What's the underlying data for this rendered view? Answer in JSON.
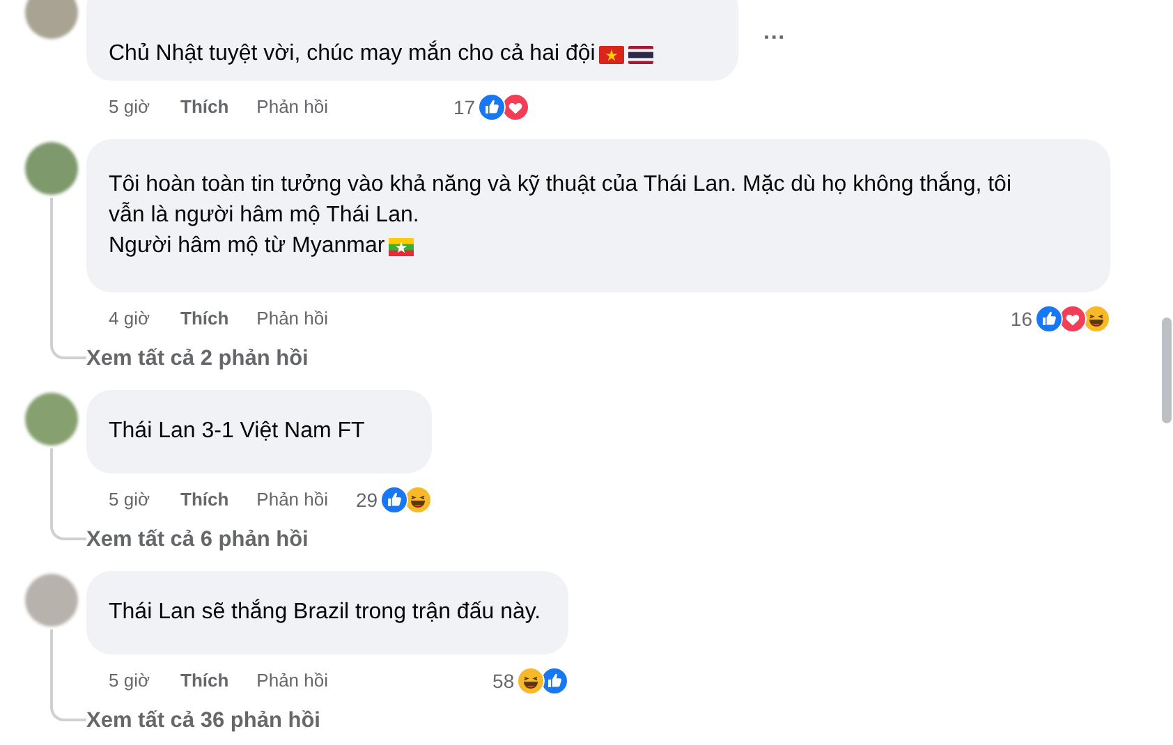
{
  "comments": [
    {
      "text": [
        "Chủ Nhật tuyệt vời, chúc may mắn cho cả hai đội"
      ],
      "flags": [
        {
          "kind": "vietnam"
        },
        {
          "kind": "thailand"
        }
      ],
      "time": "5 giờ",
      "like": "Thích",
      "reply": "Phản hồi",
      "reaction_count": "17",
      "reactions": [
        {
          "kind": "like"
        },
        {
          "kind": "love"
        }
      ],
      "more": "···"
    },
    {
      "text": [
        "Tôi hoàn toàn tin tưởng vào khả năng và kỹ thuật của Thái Lan. Mặc dù họ không thắng, tôi vẫn là người hâm mộ Thái Lan.",
        "Người hâm mộ từ Myanmar"
      ],
      "flags": [
        {
          "kind": "myanmar"
        }
      ],
      "time": "4 giờ",
      "like": "Thích",
      "reply": "Phản hồi",
      "reaction_count": "16",
      "reactions": [
        {
          "kind": "like"
        },
        {
          "kind": "love"
        },
        {
          "kind": "haha"
        }
      ],
      "view_replies": "Xem tất cả 2 phản hồi"
    },
    {
      "text": [
        "Thái Lan 3-1 Việt Nam FT"
      ],
      "time": "5 giờ",
      "like": "Thích",
      "reply": "Phản hồi",
      "reaction_count": "29",
      "reactions": [
        {
          "kind": "like"
        },
        {
          "kind": "haha"
        }
      ],
      "view_replies": "Xem tất cả 6 phản hồi"
    },
    {
      "text": [
        "Thái Lan sẽ thắng Brazil trong trận đấu này."
      ],
      "time": "5 giờ",
      "like": "Thích",
      "reply": "Phản hồi",
      "reaction_count": "58",
      "reactions": [
        {
          "kind": "haha"
        },
        {
          "kind": "like"
        }
      ],
      "view_replies": "Xem tất cả 36 phản hồi"
    }
  ]
}
